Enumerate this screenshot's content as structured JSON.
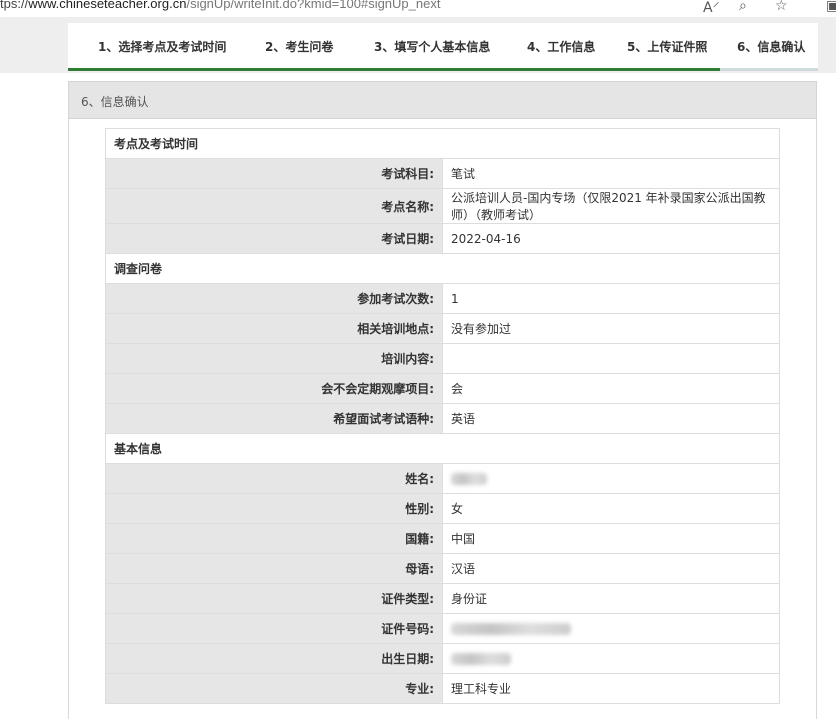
{
  "browser": {
    "url_prefix": "tps://",
    "url_host": "www.chineseteacher.org.cn",
    "url_path": "/signUp/writeInit.do?kmid=100#signUp_next",
    "icons": [
      "read-aloud-icon",
      "zoom-icon",
      "favorite-add-icon"
    ]
  },
  "steps": [
    {
      "label": "1、选择考点及考试时间"
    },
    {
      "label": "2、考生问卷"
    },
    {
      "label": "3、填写个人基本信息"
    },
    {
      "label": "4、工作信息"
    },
    {
      "label": "5、上传证件照"
    },
    {
      "label": "6、信息确认"
    }
  ],
  "active_step": 6,
  "panel": {
    "title": "6、信息确认"
  },
  "sections": {
    "exam": {
      "title": "考点及考试时间",
      "rows": [
        {
          "label": "考试科目:",
          "value": "笔试"
        },
        {
          "label": "考点名称:",
          "value": "公派培训人员-国内专场（仅限2021 年补录国家公派出国教师）（教师考试）"
        },
        {
          "label": "考试日期:",
          "value": "2022-04-16"
        }
      ]
    },
    "survey": {
      "title": "调查问卷",
      "rows": [
        {
          "label": "参加考试次数:",
          "value": "1"
        },
        {
          "label": "相关培训地点:",
          "value": "没有参加过"
        },
        {
          "label": "培训内容:",
          "value": ""
        },
        {
          "label": "会不会定期观摩项目:",
          "value": "会"
        },
        {
          "label": "希望面试考试语种:",
          "value": "英语"
        }
      ]
    },
    "basic": {
      "title": "基本信息",
      "rows": [
        {
          "label": "姓名:",
          "value": ""
        },
        {
          "label": "性别:",
          "value": "女"
        },
        {
          "label": "国籍:",
          "value": "中国"
        },
        {
          "label": "母语:",
          "value": "汉语"
        },
        {
          "label": "证件类型:",
          "value": "身份证"
        },
        {
          "label": "证件号码:",
          "value": ""
        },
        {
          "label": "出生日期:",
          "value": ""
        },
        {
          "label": "专业:",
          "value": "理工科专业"
        }
      ]
    }
  },
  "colors": {
    "step_line": "#2e7d32",
    "label_bg": "#e6e6e6",
    "panel_head_bg": "#e5e5e5"
  }
}
